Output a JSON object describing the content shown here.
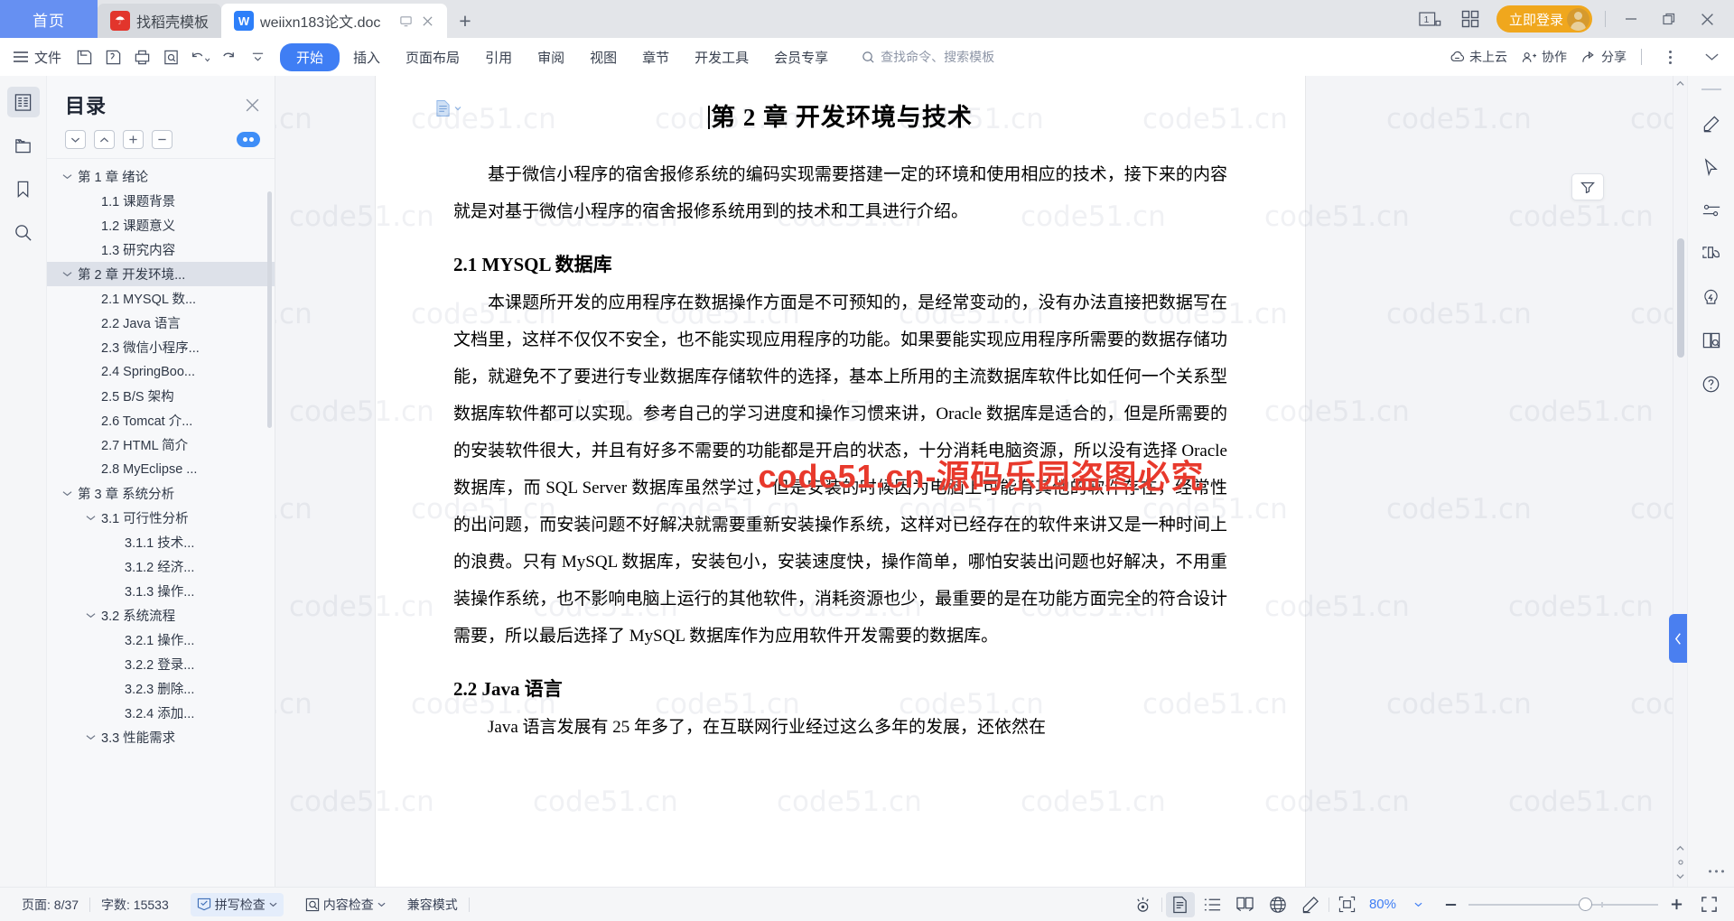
{
  "tabbar": {
    "home_label": "首页",
    "tabs": [
      {
        "title": "找稻壳模板",
        "icon": "docer-logo-icon",
        "active": false
      },
      {
        "title": "weiixn183论文.doc",
        "icon": "wps-writer-icon",
        "active": true
      }
    ],
    "new_tab": "+",
    "right": {
      "page_count_icon": "1",
      "grid_icon": "grid-icon",
      "login_label": "立即登录",
      "minimize": "—",
      "restore": "❐",
      "close": "✕"
    }
  },
  "ribbon": {
    "menu_label": "文件",
    "quick_icons": [
      "save-icon",
      "save-as-icon",
      "print-icon",
      "print-preview-icon",
      "undo-icon",
      "redo-icon",
      "customize-icon"
    ],
    "tabs": [
      {
        "label": "开始",
        "active": true
      },
      {
        "label": "插入",
        "active": false
      },
      {
        "label": "页面布局",
        "active": false
      },
      {
        "label": "引用",
        "active": false
      },
      {
        "label": "审阅",
        "active": false
      },
      {
        "label": "视图",
        "active": false
      },
      {
        "label": "章节",
        "active": false
      },
      {
        "label": "开发工具",
        "active": false
      },
      {
        "label": "会员专享",
        "active": false
      }
    ],
    "search_placeholder": "查找命令、搜索模板",
    "right_items": [
      {
        "label": "未上云",
        "icon": "cloud-off-icon"
      },
      {
        "label": "协作",
        "icon": "collaborate-icon"
      },
      {
        "label": "分享",
        "icon": "share-icon"
      }
    ],
    "more_icon": "more-vertical-icon",
    "collapse_icon": "chevron-down-icon"
  },
  "leftrail": {
    "items": [
      {
        "name": "outline-panel",
        "icon": "document-outline-icon",
        "active": true
      },
      {
        "name": "sections-panel",
        "icon": "sections-icon",
        "active": false
      },
      {
        "name": "bookmark-panel",
        "icon": "bookmark-icon",
        "active": false
      },
      {
        "name": "search-panel",
        "icon": "search-icon",
        "active": false
      }
    ]
  },
  "outline": {
    "title": "目录",
    "close_icon": "close-icon",
    "tools": [
      {
        "name": "expand-all-button",
        "icon": "chevron-down-icon"
      },
      {
        "name": "collapse-all-button",
        "icon": "chevron-up-icon"
      },
      {
        "name": "increase-level-button",
        "icon": "plus-icon"
      },
      {
        "name": "decrease-level-button",
        "icon": "minus-icon"
      }
    ],
    "eye_toggle": "eye-toggle-icon",
    "items": [
      {
        "label": "第 1 章 绪论",
        "indent": 0,
        "arrow": "expanded",
        "selected": false
      },
      {
        "label": "1.1 课题背景",
        "indent": 1,
        "arrow": "none",
        "selected": false
      },
      {
        "label": "1.2 课题意义",
        "indent": 1,
        "arrow": "none",
        "selected": false
      },
      {
        "label": "1.3 研究内容",
        "indent": 1,
        "arrow": "none",
        "selected": false
      },
      {
        "label": "第 2 章 开发环境...",
        "indent": 0,
        "arrow": "expanded",
        "selected": true
      },
      {
        "label": "2.1 MYSQL 数...",
        "indent": 1,
        "arrow": "none",
        "selected": false
      },
      {
        "label": "2.2 Java 语言",
        "indent": 1,
        "arrow": "none",
        "selected": false
      },
      {
        "label": "2.3 微信小程序...",
        "indent": 1,
        "arrow": "none",
        "selected": false
      },
      {
        "label": "2.4 SpringBoo...",
        "indent": 1,
        "arrow": "none",
        "selected": false
      },
      {
        "label": "2.5 B/S 架构",
        "indent": 1,
        "arrow": "none",
        "selected": false
      },
      {
        "label": "2.6 Tomcat 介...",
        "indent": 1,
        "arrow": "none",
        "selected": false
      },
      {
        "label": "2.7 HTML 简介",
        "indent": 1,
        "arrow": "none",
        "selected": false
      },
      {
        "label": "2.8 MyEclipse ...",
        "indent": 1,
        "arrow": "none",
        "selected": false
      },
      {
        "label": "第 3 章 系统分析",
        "indent": 0,
        "arrow": "expanded",
        "selected": false
      },
      {
        "label": "3.1 可行性分析",
        "indent": 1,
        "arrow": "expanded",
        "selected": false
      },
      {
        "label": "3.1.1 技术...",
        "indent": 2,
        "arrow": "none",
        "selected": false
      },
      {
        "label": "3.1.2 经济...",
        "indent": 2,
        "arrow": "none",
        "selected": false
      },
      {
        "label": "3.1.3 操作...",
        "indent": 2,
        "arrow": "none",
        "selected": false
      },
      {
        "label": "3.2 系统流程",
        "indent": 1,
        "arrow": "expanded",
        "selected": false
      },
      {
        "label": "3.2.1 操作...",
        "indent": 2,
        "arrow": "none",
        "selected": false
      },
      {
        "label": "3.2.2 登录...",
        "indent": 2,
        "arrow": "none",
        "selected": false
      },
      {
        "label": "3.2.3 删除...",
        "indent": 2,
        "arrow": "none",
        "selected": false
      },
      {
        "label": "3.2.4 添加...",
        "indent": 2,
        "arrow": "none",
        "selected": false
      },
      {
        "label": "3.3 性能需求",
        "indent": 1,
        "arrow": "expanded",
        "selected": false
      }
    ]
  },
  "document": {
    "heading1": "第 2 章 开发环境与技术",
    "paragraphs": [
      {
        "type": "p",
        "text": "基于微信小程序的宿舍报修系统的编码实现需要搭建一定的环境和使用相应的技术，接下来的内容就是对基于微信小程序的宿舍报修系统用到的技术和工具进行介绍。"
      },
      {
        "type": "h2",
        "text": "2.1 MYSQL 数据库"
      },
      {
        "type": "p",
        "text": "本课题所开发的应用程序在数据操作方面是不可预知的，是经常变动的，没有办法直接把数据写在文档里，这样不仅仅不安全，也不能实现应用程序的功能。如果要能实现应用程序所需要的数据存储功能，就避免不了要进行专业数据库存储软件的选择，基本上所用的主流数据库软件比如任何一个关系型数据库软件都可以实现。参考自己的学习进度和操作习惯来讲，Oracle 数据库是适合的，但是所需要的的安装软件很大，并且有好多不需要的功能都是开启的状态，十分消耗电脑资源，所以没有选择 Oracle 数据库，而 SQL Server 数据库虽然学过，但是安装的时候因为电脑上可能有其他的软件存在，经常性的出问题，而安装问题不好解决就需要重新安装操作系统，这样对已经存在的软件来讲又是一种时间上的浪费。只有 MySQL 数据库，安装包小，安装速度快，操作简单，哪怕安装出问题也好解决，不用重装操作系统，也不影响电脑上运行的其他软件，消耗资源也少，最重要的是在功能方面完全的符合设计需要，所以最后选择了 MySQL 数据库作为应用软件开发需要的数据库。"
      },
      {
        "type": "h2",
        "text": "2.2 Java 语言"
      },
      {
        "type": "p",
        "text": "Java 语言发展有 25 年多了，在互联网行业经过这么多年的发展，还依然在"
      }
    ],
    "watermark_text": "code51.cn",
    "watermark_red": "code51.cn-源码乐园盗图必究",
    "doc_icon": "page-layout-icon"
  },
  "rightrail": {
    "items": [
      {
        "name": "pen-tool",
        "icon": "pen-icon"
      },
      {
        "name": "select-tool",
        "icon": "cursor-icon"
      },
      {
        "name": "settings-tool",
        "icon": "sliders-icon"
      },
      {
        "name": "ocr-tool",
        "icon": "scan-leaf-icon"
      },
      {
        "name": "ai-tool",
        "icon": "lightning-bulb-icon"
      },
      {
        "name": "reading-tool",
        "icon": "book-search-icon"
      },
      {
        "name": "help-tool",
        "icon": "question-circle-icon"
      }
    ],
    "collapse_icon": "chevron-left-icon",
    "filter_icon": "filter-icon",
    "dots_icon": "more-horizontal-icon"
  },
  "status": {
    "page_label": "页面: 8/37",
    "word_count_label": "字数: 15533",
    "spellcheck_label": "拼写检查",
    "contentcheck_label": "内容检查",
    "compat_label": "兼容模式",
    "view_buttons": [
      {
        "name": "focus-view",
        "icon": "eye-focus-icon",
        "active": false
      },
      {
        "name": "page-view",
        "icon": "page-icon",
        "active": true
      },
      {
        "name": "outline-view",
        "icon": "list-icon",
        "active": false
      },
      {
        "name": "reading-view",
        "icon": "book-icon",
        "active": false
      },
      {
        "name": "web-view",
        "icon": "globe-icon",
        "active": false
      },
      {
        "name": "write-view",
        "icon": "pen-write-icon",
        "active": false
      }
    ],
    "fit_icon": "fit-page-icon",
    "zoom_value": "80%",
    "zoom_out": "−",
    "zoom_in": "+",
    "fullscreen_icon": "fullscreen-icon"
  },
  "colors": {
    "accent": "#3f7ef4",
    "home_tab": "#6690f2",
    "login": "#f0a71d",
    "watermark_red": "#e8392c"
  }
}
